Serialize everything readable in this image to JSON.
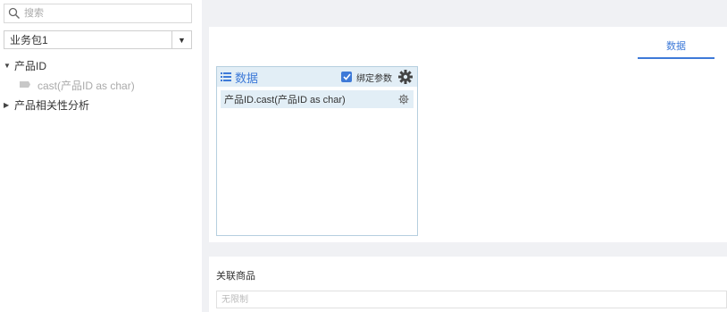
{
  "sidebar": {
    "search": {
      "placeholder": "搜索",
      "icon": "search-icon"
    },
    "package_select": {
      "value": "业务包1",
      "arrow": "▼"
    },
    "tree": [
      {
        "label": "产品ID",
        "expanded": true,
        "children": [
          {
            "label": "cast(产品ID as char)",
            "icon": "field-icon"
          }
        ]
      },
      {
        "label": "产品相关性分析",
        "expanded": false
      }
    ]
  },
  "main": {
    "tab": {
      "label": "数据",
      "active": true
    },
    "data_box": {
      "title": "数据",
      "bind_params_label": "绑定参数",
      "bind_params_checked": true,
      "items": [
        {
          "label": "产品ID.cast(产品ID as char)"
        }
      ]
    },
    "related": {
      "title": "关联商品",
      "placeholder": "无限制"
    }
  },
  "colors": {
    "accent": "#3e7ad8",
    "panel_bg": "#f0f1f4",
    "header_bg": "#e2eef6",
    "border": "#b6cfdf"
  }
}
